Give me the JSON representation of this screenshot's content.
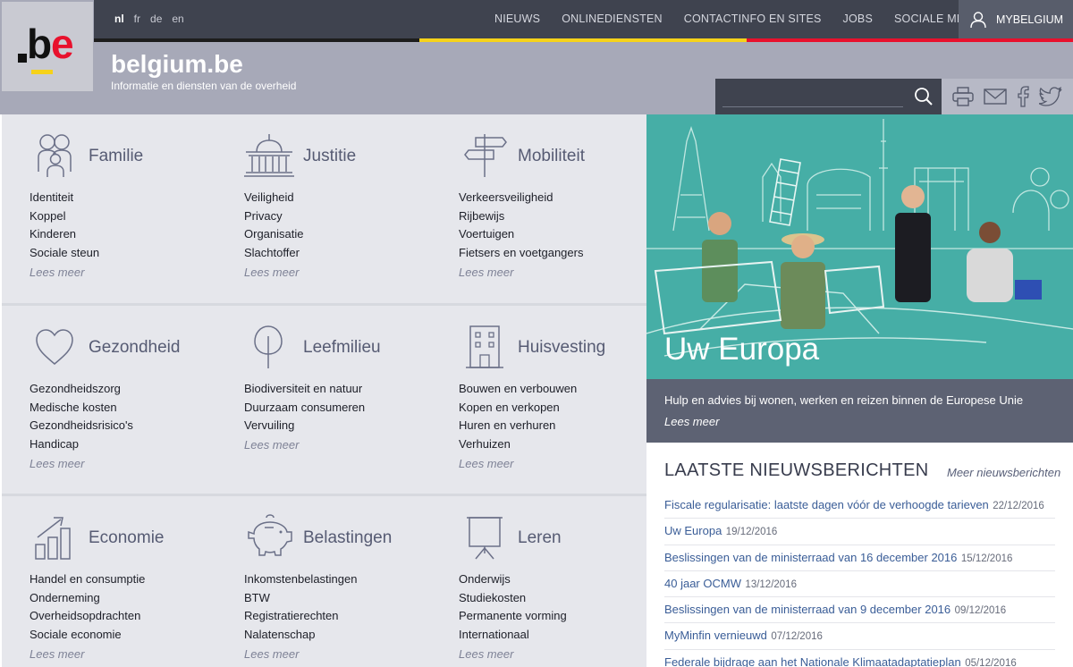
{
  "header": {
    "logo_text": ".be",
    "site_name": "belgium.be",
    "tagline": "Informatie en diensten van de overheid",
    "languages": [
      "nl",
      "fr",
      "de",
      "en"
    ],
    "active_language": "nl",
    "nav": [
      "NIEUWS",
      "ONLINEDIENSTEN",
      "CONTACTINFO EN SITES",
      "JOBS",
      "SOCIALE MEDIA"
    ],
    "account_label": "MYBELGIUM",
    "search_placeholder": "",
    "tools": [
      "print-icon",
      "mail-icon",
      "facebook-icon",
      "twitter-icon"
    ]
  },
  "categories": [
    {
      "title": "Familie",
      "icon": "family-icon",
      "items": [
        "Identiteit",
        "Koppel",
        "Kinderen",
        "Sociale steun"
      ],
      "more": "Lees meer"
    },
    {
      "title": "Justitie",
      "icon": "courthouse-icon",
      "items": [
        "Veiligheid",
        "Privacy",
        "Organisatie",
        "Slachtoffer"
      ],
      "more": "Lees meer"
    },
    {
      "title": "Mobiliteit",
      "icon": "signpost-icon",
      "items": [
        "Verkeersveiligheid",
        "Rijbewijs",
        "Voertuigen",
        "Fietsers en voetgangers"
      ],
      "more": "Lees meer"
    },
    {
      "title": "Gezondheid",
      "icon": "heart-icon",
      "items": [
        "Gezondheidszorg",
        "Medische kosten",
        "Gezondheidsrisico's",
        "Handicap"
      ],
      "more": "Lees meer"
    },
    {
      "title": "Leefmilieu",
      "icon": "tree-icon",
      "items": [
        "Biodiversiteit en natuur",
        "Duurzaam consumeren",
        "Vervuiling"
      ],
      "more": "Lees meer"
    },
    {
      "title": "Huisvesting",
      "icon": "building-icon",
      "items": [
        "Bouwen en verbouwen",
        "Kopen en verkopen",
        "Huren en verhuren",
        "Verhuizen"
      ],
      "more": "Lees meer"
    },
    {
      "title": "Economie",
      "icon": "growth-chart-icon",
      "items": [
        "Handel en consumptie",
        "Onderneming",
        "Overheidsopdrachten",
        "Sociale economie"
      ],
      "more": "Lees meer"
    },
    {
      "title": "Belastingen",
      "icon": "piggy-bank-icon",
      "items": [
        "Inkomstenbelastingen",
        "BTW",
        "Registratierechten",
        "Nalatenschap"
      ],
      "more": "Lees meer"
    },
    {
      "title": "Leren",
      "icon": "presentation-board-icon",
      "items": [
        "Onderwijs",
        "Studiekosten",
        "Permanente vorming",
        "Internationaal"
      ],
      "more": "Lees meer"
    }
  ],
  "hero": {
    "title": "Uw Europa",
    "description": "Hulp en advies bij wonen, werken en reizen binnen de Europese Unie",
    "more": "Lees meer"
  },
  "news": {
    "heading": "LAATSTE NIEUWSBERICHTEN",
    "more": "Meer nieuwsberichten",
    "items": [
      {
        "title": "Fiscale regularisatie: laatste dagen vóór de verhoogde tarieven",
        "date": "22/12/2016"
      },
      {
        "title": "Uw Europa",
        "date": "19/12/2016"
      },
      {
        "title": "Beslissingen van de ministerraad van 16 december 2016",
        "date": "15/12/2016"
      },
      {
        "title": "40 jaar OCMW",
        "date": "13/12/2016"
      },
      {
        "title": "Beslissingen van de ministerraad van 9 december 2016",
        "date": "09/12/2016"
      },
      {
        "title": "MyMinfin vernieuwd",
        "date": "07/12/2016"
      },
      {
        "title": "Federale bijdrage aan het Nationale Klimaatadaptatieplan",
        "date": "05/12/2016"
      }
    ]
  }
}
